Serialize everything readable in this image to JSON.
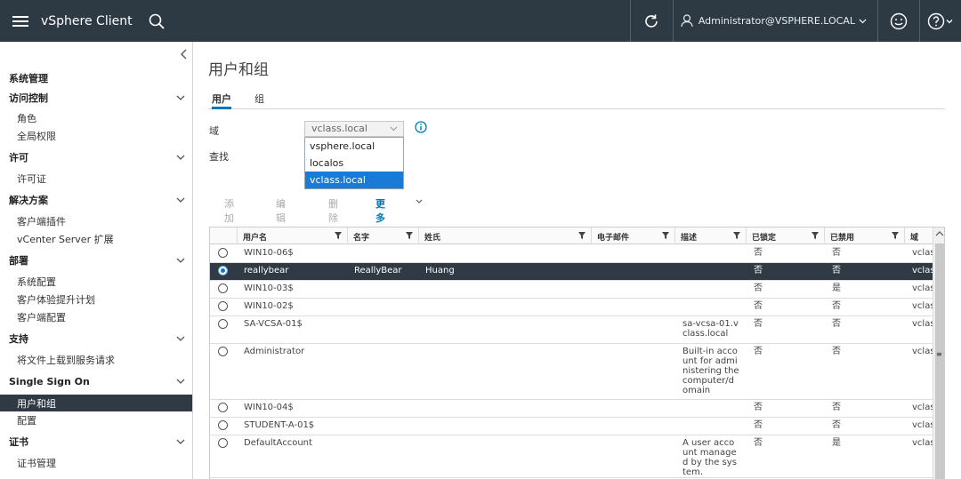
{
  "header": {
    "brand": "vSphere Client",
    "user": "Administrator@VSPHERE.LOCAL"
  },
  "sidebar": {
    "sections": [
      {
        "label": "系统管理"
      },
      {
        "label": "访问控制",
        "items": [
          "角色",
          "全局权限"
        ]
      },
      {
        "label": "许可",
        "items": [
          "许可证"
        ]
      },
      {
        "label": "解决方案",
        "items": [
          "客户端插件",
          "vCenter Server 扩展"
        ]
      },
      {
        "label": "部署",
        "items": [
          "系统配置",
          "客户体验提升计划",
          "客户端配置"
        ]
      },
      {
        "label": "支持",
        "items": [
          "将文件上载到服务请求"
        ]
      },
      {
        "label": "Single Sign On",
        "items": [
          "用户和组",
          "配置"
        ]
      },
      {
        "label": "证书",
        "items": [
          "证书管理"
        ]
      }
    ],
    "active": "用户和组"
  },
  "main": {
    "title": "用户和组",
    "tabs": [
      "用户",
      "组"
    ],
    "active_tab": "用户",
    "domain_label": "域",
    "search_label": "查找",
    "domain_value": "vclass.local",
    "domain_options": [
      "vsphere.local",
      "localos",
      "vclass.local"
    ],
    "selected_option": "vclass.local",
    "toolbar": {
      "add": "添加",
      "edit": "编辑",
      "delete": "删除",
      "more": "更多"
    }
  },
  "grid": {
    "columns": [
      "用户名",
      "名字",
      "姓氏",
      "电子邮件",
      "描述",
      "已锁定",
      "已禁用",
      "域"
    ],
    "rows": [
      {
        "username": "WIN10-06$",
        "first": "",
        "last": "",
        "email": "",
        "desc": "",
        "locked": "否",
        "disabled": "否",
        "domain": "vclas",
        "selected": false
      },
      {
        "username": "reallybear",
        "first": "ReallyBear",
        "last": "Huang",
        "email": "",
        "desc": "",
        "locked": "否",
        "disabled": "否",
        "domain": "vclas",
        "selected": true
      },
      {
        "username": "WIN10-03$",
        "first": "",
        "last": "",
        "email": "",
        "desc": "",
        "locked": "否",
        "disabled": "是",
        "domain": "vclas",
        "selected": false
      },
      {
        "username": "WIN10-02$",
        "first": "",
        "last": "",
        "email": "",
        "desc": "",
        "locked": "否",
        "disabled": "否",
        "domain": "vclas",
        "selected": false
      },
      {
        "username": "SA-VCSA-01$",
        "first": "",
        "last": "",
        "email": "",
        "desc": "sa-vcsa-01.v\nclass.local",
        "locked": "否",
        "disabled": "否",
        "domain": "vclas",
        "selected": false
      },
      {
        "username": "Administrator",
        "first": "",
        "last": "",
        "email": "",
        "desc": "Built-in acco\nunt for admi\nnistering the\ncomputer/d\nomain",
        "locked": "否",
        "disabled": "否",
        "domain": "vclas",
        "selected": false
      },
      {
        "username": "WIN10-04$",
        "first": "",
        "last": "",
        "email": "",
        "desc": "",
        "locked": "否",
        "disabled": "否",
        "domain": "vclas",
        "selected": false
      },
      {
        "username": "STUDENT-A-01$",
        "first": "",
        "last": "",
        "email": "",
        "desc": "",
        "locked": "否",
        "disabled": "否",
        "domain": "vclas",
        "selected": false
      },
      {
        "username": "DefaultAccount",
        "first": "",
        "last": "",
        "email": "",
        "desc": "A user acco\nunt manage\nd by the sys\ntem.",
        "locked": "否",
        "disabled": "是",
        "domain": "vclas",
        "selected": false
      }
    ]
  }
}
